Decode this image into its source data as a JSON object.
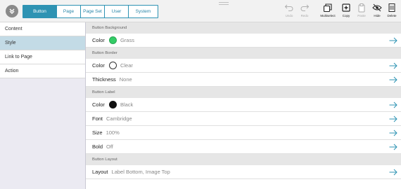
{
  "toolbar": {
    "tabs": [
      {
        "label": "Button",
        "active": true
      },
      {
        "label": "Page",
        "active": false
      },
      {
        "label": "Page Set",
        "active": false
      },
      {
        "label": "User",
        "active": false
      },
      {
        "label": "System",
        "active": false
      }
    ],
    "tools": {
      "undo": "Undo",
      "redo": "Redo",
      "multiselect": "Multiselect",
      "copy": "Copy",
      "paste": "Paste",
      "hide": "Hide",
      "delete": "Delete"
    }
  },
  "sidebar": {
    "items": [
      {
        "label": "Content",
        "active": false
      },
      {
        "label": "Style",
        "active": true
      },
      {
        "label": "Link to Page",
        "active": false
      },
      {
        "label": "Action",
        "active": false
      }
    ]
  },
  "sections": [
    {
      "header": "Button Background",
      "rows": [
        {
          "label": "Color",
          "value": "Grass",
          "swatch": "#33cc66"
        }
      ]
    },
    {
      "header": "Button Border",
      "rows": [
        {
          "label": "Color",
          "value": "Clear",
          "swatch": "clear"
        },
        {
          "label": "Thickness",
          "value": "None"
        }
      ]
    },
    {
      "header": "Button Label",
      "rows": [
        {
          "label": "Color",
          "value": "Black",
          "swatch": "#111111"
        },
        {
          "label": "Font",
          "value": "Cambridge"
        },
        {
          "label": "Size",
          "value": "100%"
        },
        {
          "label": "Bold",
          "value": "Off"
        }
      ]
    },
    {
      "header": "Button Layout",
      "rows": [
        {
          "label": "Layout",
          "value": "Label Bottom, Image Top"
        }
      ]
    }
  ],
  "colors": {
    "accent": "#2e93b3",
    "arrow": "#2e93b3",
    "sidebar_active": "#c3dbe6"
  }
}
